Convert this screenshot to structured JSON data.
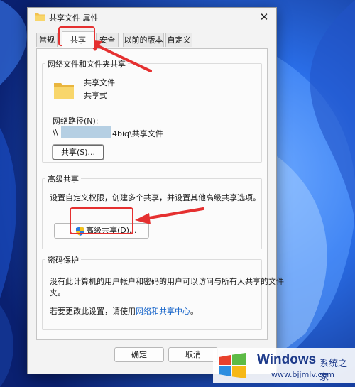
{
  "window": {
    "title": "共享文件 属性",
    "close_label": "✕"
  },
  "tabs": [
    {
      "label": "常规"
    },
    {
      "label": "共享"
    },
    {
      "label": "安全"
    },
    {
      "label": "以前的版本"
    },
    {
      "label": "自定义"
    }
  ],
  "network_sharing": {
    "legend": "网络文件和文件夹共享",
    "folder_name": "共享文件",
    "share_state": "共享式",
    "path_label": "网络路径(N):",
    "path_prefix": "\\\\",
    "path_suffix": "4biq\\共享文件",
    "share_button": "共享(S)..."
  },
  "advanced_sharing": {
    "legend": "高级共享",
    "description": "设置自定义权限，创建多个共享，并设置其他高级共享选项。",
    "button": "高级共享(D)..."
  },
  "password": {
    "legend": "密码保护",
    "line1": "没有此计算机的用户帐户和密码的用户可以访问与所有人共享的文件",
    "line2": "夹。",
    "change_prefix": "若要更改此设置，请使用",
    "link": "网络和共享中心",
    "change_suffix": "。"
  },
  "footer": {
    "ok": "确定",
    "cancel": "取消"
  },
  "watermark": {
    "title": "Windows",
    "subtitle": "系统之家",
    "url": "www.bjjmlv.com"
  },
  "colors": {
    "highlight": "#e53030",
    "link": "#1060c8",
    "wallpaper": "#0a2f86"
  },
  "icons": [
    "folder-icon",
    "shield-icon",
    "close-icon",
    "windows-logo-icon"
  ]
}
